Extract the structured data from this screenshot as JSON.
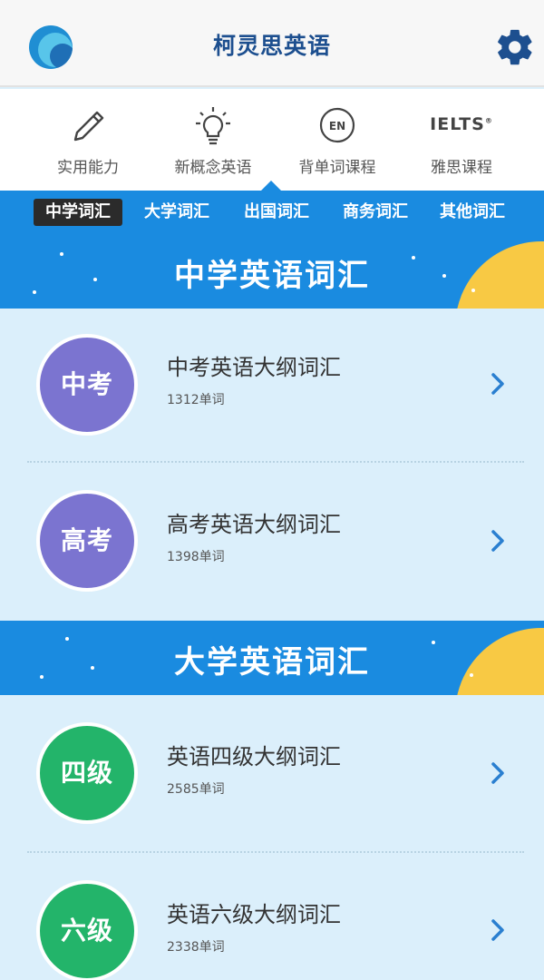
{
  "app": {
    "title": "柯灵思英语"
  },
  "categories": [
    {
      "label": "实用能力",
      "icon": "pencil-icon"
    },
    {
      "label": "新概念英语",
      "icon": "lightbulb-icon"
    },
    {
      "label": "背单词课程",
      "icon": "en-circle-icon",
      "icon_text": "EN"
    },
    {
      "label": "雅思课程",
      "icon": "ielts-icon",
      "icon_text": "IELTS"
    }
  ],
  "tabs": [
    {
      "label": "中学词汇",
      "active": true
    },
    {
      "label": "大学词汇",
      "active": false
    },
    {
      "label": "出国词汇",
      "active": false
    },
    {
      "label": "商务词汇",
      "active": false
    },
    {
      "label": "其他词汇",
      "active": false
    }
  ],
  "sections": [
    {
      "title": "中学英语词汇",
      "items": [
        {
          "badge": "中考",
          "name": "中考英语大纲词汇",
          "count": "1312单词",
          "color": "#7b74d0"
        },
        {
          "badge": "高考",
          "name": "高考英语大纲词汇",
          "count": "1398单词",
          "color": "#7b74d0"
        }
      ]
    },
    {
      "title": "大学英语词汇",
      "items": [
        {
          "badge": "四级",
          "name": "英语四级大纲词汇",
          "count": "2585单词",
          "color": "#23b46a"
        },
        {
          "badge": "六级",
          "name": "英语六级大纲词汇",
          "count": "2338单词",
          "color": "#23b46a"
        }
      ]
    }
  ],
  "colors": {
    "accent_blue": "#1a8be0",
    "sun_yellow": "#f8c944",
    "badge_purple": "#7b74d0",
    "badge_green": "#23b46a",
    "chevron": "#2a7fd0"
  }
}
